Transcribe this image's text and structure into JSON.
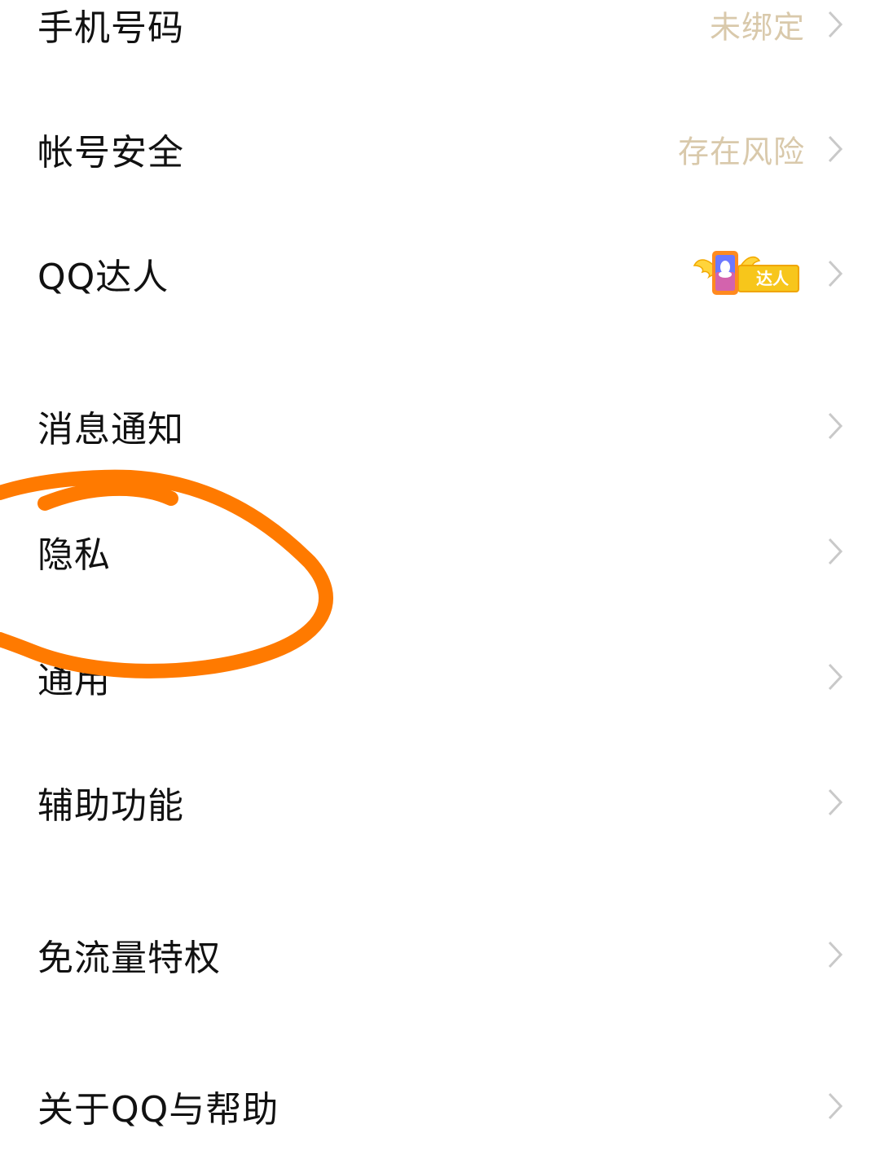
{
  "settings": {
    "items": [
      {
        "label": "手机号码",
        "value": "未绑定"
      },
      {
        "label": "帐号安全",
        "value": "存在风险"
      },
      {
        "label": "QQ达人",
        "badge_text": "达人"
      },
      {
        "label": "消息通知"
      },
      {
        "label": "隐私"
      },
      {
        "label": "通用"
      },
      {
        "label": "辅助功能"
      },
      {
        "label": "免流量特权"
      },
      {
        "label": "关于QQ与帮助"
      }
    ]
  },
  "colors": {
    "value_text": "#d9c9ab",
    "chevron": "#c9c9c9",
    "annotation": "#ff7a00",
    "badge_gold": "#f7c61b"
  },
  "icons": {
    "chevron": "chevron-right-icon",
    "badge": "qq-daren-badge-icon"
  }
}
